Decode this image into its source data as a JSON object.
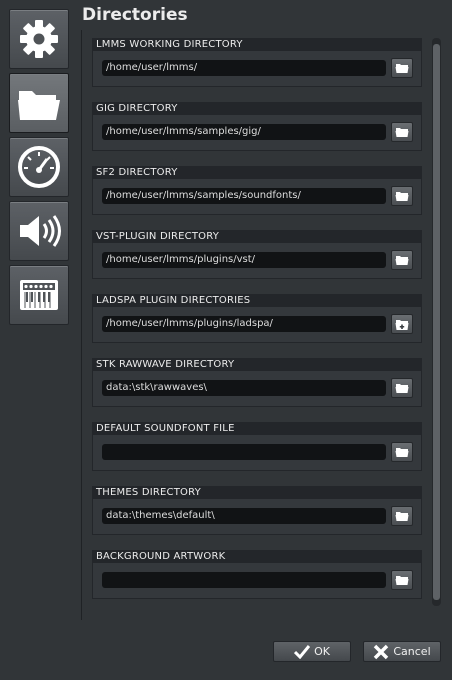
{
  "page": {
    "title": "Directories"
  },
  "tabs": [
    {
      "name": "settings",
      "icon": "gear-icon"
    },
    {
      "name": "directories",
      "icon": "folder-icon",
      "active": true
    },
    {
      "name": "performance",
      "icon": "speedometer-icon"
    },
    {
      "name": "audio",
      "icon": "speaker-icon"
    },
    {
      "name": "midi",
      "icon": "keyboard-icon"
    }
  ],
  "groups": [
    {
      "label": "LMMS WORKING DIRECTORY",
      "value": "/home/user/lmms/",
      "button": "folder-icon"
    },
    {
      "label": "GIG DIRECTORY",
      "value": "/home/user/lmms/samples/gig/",
      "button": "folder-icon"
    },
    {
      "label": "SF2 DIRECTORY",
      "value": "/home/user/lmms/samples/soundfonts/",
      "button": "folder-icon"
    },
    {
      "label": "VST-PLUGIN DIRECTORY",
      "value": "/home/user/lmms/plugins/vst/",
      "button": "folder-icon"
    },
    {
      "label": "LADSPA PLUGIN DIRECTORIES",
      "value": "/home/user/lmms/plugins/ladspa/",
      "button": "folder-add-icon"
    },
    {
      "label": "STK RAWWAVE DIRECTORY",
      "value": "data:\\stk\\rawwaves\\",
      "button": "folder-icon"
    },
    {
      "label": "DEFAULT SOUNDFONT FILE",
      "value": "",
      "button": "folder-icon"
    },
    {
      "label": "THEMES DIRECTORY",
      "value": "data:\\themes\\default\\",
      "button": "folder-icon"
    },
    {
      "label": "BACKGROUND ARTWORK",
      "value": "",
      "button": "folder-icon"
    }
  ],
  "buttons": {
    "ok": "OK",
    "cancel": "Cancel"
  }
}
